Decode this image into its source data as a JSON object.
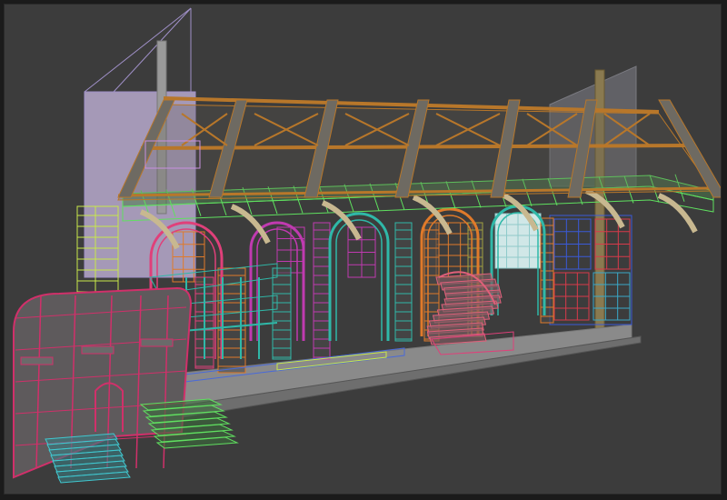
{
  "viewport": {
    "mode": "wireframe-3d-view",
    "background_color": "#3c3c3c"
  },
  "scene": {
    "subject": "hall-with-arches-and-roof-trusses",
    "colors": {
      "roof_truss": "#b8772a",
      "roof_beam_fill": "#6e6a62",
      "platform_green": "#5fe05f",
      "wall_magenta": "#c03ab0",
      "wall_teal": "#2fb8a8",
      "wall_orange": "#e07a2a",
      "wall_pink": "#e0407a",
      "wall_blue": "#3a5ad8",
      "wall_red": "#d83a4a",
      "tower_yellow_green": "#c8e84a",
      "entrance_crimson": "#d0306a",
      "stairs_cyan": "#40c8d0",
      "stairs_green": "#60e060",
      "spiral_stair_pink": "#e0607a",
      "backdrop_lilac": "#c8b8e0",
      "floor_gray": "#8a8a8a",
      "window_light": "#d8f0f0"
    }
  }
}
